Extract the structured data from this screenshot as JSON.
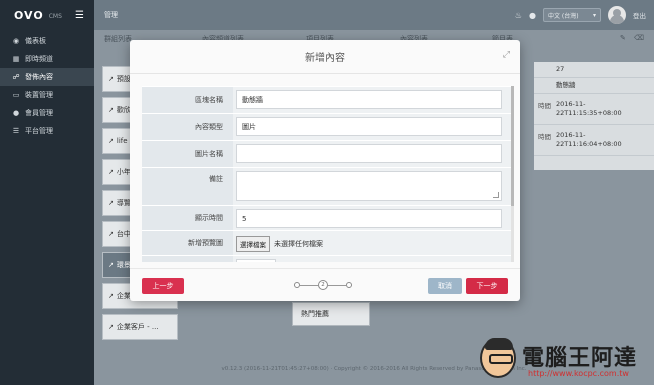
{
  "app": {
    "logo": "OVO",
    "logo_sub": "CMS",
    "breadcrumb": "管理"
  },
  "sidebar": {
    "items": [
      {
        "label": "儀表板",
        "icon": "dashboard-icon"
      },
      {
        "label": "即時頻道",
        "icon": "grid-icon"
      },
      {
        "label": "發佈內容",
        "icon": "share-icon",
        "active": true
      },
      {
        "label": "裝置管理",
        "icon": "monitor-icon"
      },
      {
        "label": "會員管理",
        "icon": "user-icon"
      },
      {
        "label": "平台管理",
        "icon": "list-icon"
      }
    ]
  },
  "topbar": {
    "language": "中文 (台灣)",
    "logout": "登出"
  },
  "background": {
    "col_heads": [
      "群組列表",
      "內容頻道列表",
      "項目列表",
      "內容列表",
      "節目表"
    ],
    "left_cards": [
      "預設",
      "歡欣",
      "life",
      "小年",
      "導覽",
      "台中",
      "環景",
      "企業",
      "企業客戶 - ..."
    ],
    "right_rows": [
      {
        "label": "",
        "value": "27"
      },
      {
        "label": "",
        "value": "動態牆"
      },
      {
        "label": "時間",
        "value": "2016-11-22T11:15:35+08:00"
      },
      {
        "label": "時間",
        "value": "2016-11-22T11:16:04+08:00"
      }
    ],
    "mid_card": "熱門推薦",
    "footer": "v0.12.3 (2016-11-21T01:45:27+08:00) · Copyright © 2016-2016 All Rights Reserved by Panasonic System Inc."
  },
  "modal": {
    "title": "新增內容",
    "fields": [
      {
        "label": "區塊名稱",
        "value": "動態牆",
        "type": "input"
      },
      {
        "label": "內容類型",
        "value": "圖片",
        "type": "input"
      },
      {
        "label": "圖片名稱",
        "value": "",
        "type": "input"
      },
      {
        "label": "備註",
        "value": "",
        "type": "textarea"
      },
      {
        "label": "顯示時間",
        "value": "5",
        "type": "input"
      },
      {
        "label": "新增預覽圖",
        "type": "file",
        "button": "選擇檔案",
        "status": "未選擇任何檔案"
      }
    ],
    "step": "2",
    "prev_label": "上一步",
    "cancel_label": "取消",
    "next_label": "下一步"
  },
  "watermark": {
    "brand": "電腦王阿達",
    "url": "http://www.kocpc.com.tw"
  }
}
